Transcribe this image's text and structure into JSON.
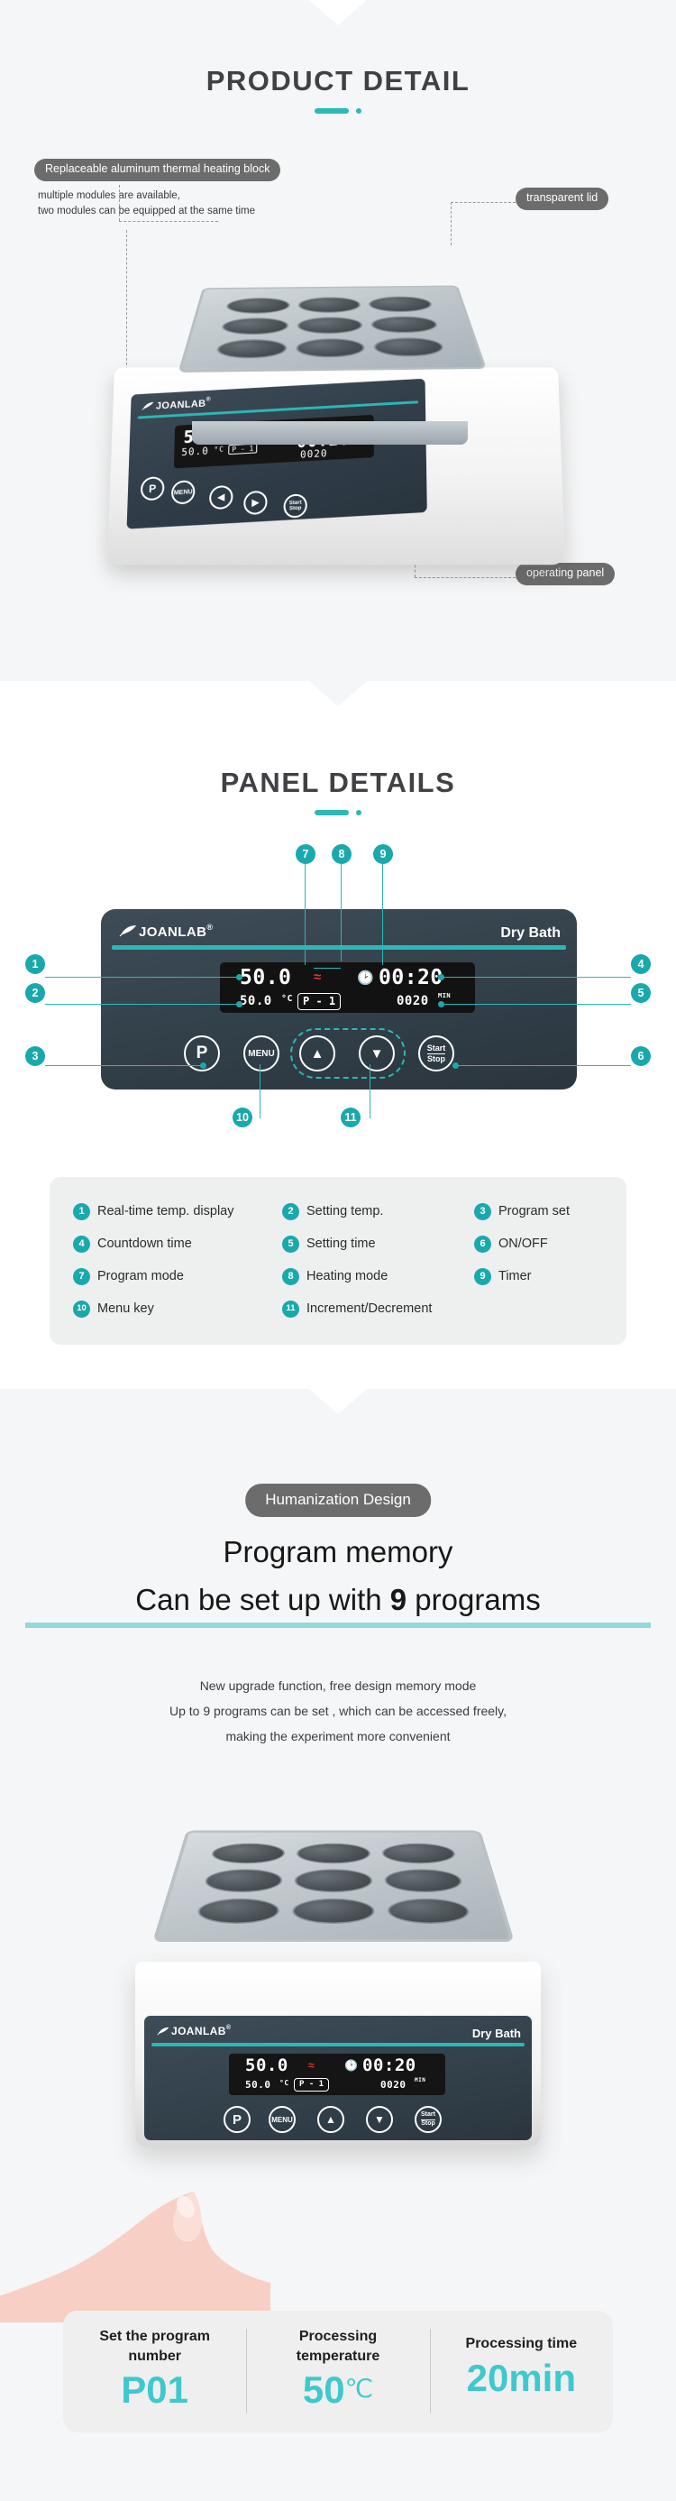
{
  "sections": {
    "product_detail": {
      "title": "PRODUCT  DETAIL",
      "labels": {
        "heating_block": "Replaceable aluminum thermal heating block",
        "heating_block_note": "multiple modules are available,\ntwo modules can be equipped at the same time",
        "transparent_lid": "transparent lid",
        "operating_panel": "operating panel"
      }
    },
    "panel_details": {
      "title": "PANEL DETAILS",
      "callouts": [
        "1",
        "2",
        "3",
        "4",
        "5",
        "6",
        "7",
        "8",
        "9",
        "10",
        "11"
      ],
      "legend": [
        {
          "num": "1",
          "label": "Real-time temp. display"
        },
        {
          "num": "2",
          "label": "Setting temp."
        },
        {
          "num": "3",
          "label": "Program set"
        },
        {
          "num": "4",
          "label": "Countdown time"
        },
        {
          "num": "5",
          "label": "Setting time"
        },
        {
          "num": "6",
          "label": "ON/OFF"
        },
        {
          "num": "7",
          "label": "Program mode"
        },
        {
          "num": "8",
          "label": "Heating mode"
        },
        {
          "num": "9",
          "label": "Timer"
        },
        {
          "num": "10",
          "label": "Menu key"
        },
        {
          "num": "11",
          "label": "Increment/Decrement"
        }
      ]
    },
    "humanization": {
      "badge": "Humanization Design",
      "headline_line1": "Program memory",
      "headline_line2_pre": "Can be set up with ",
      "headline_line2_strong": "9",
      "headline_line2_post": " programs",
      "paragraph": "New upgrade function, free design memory mode\nUp to 9 programs can be set , which can be accessed freely,\nmaking the experiment more convenient"
    }
  },
  "device": {
    "brand": "JOANLAB",
    "model": "Dry Bath",
    "display": {
      "current_temp": "50.0",
      "set_temp": "50.0",
      "temp_unit": "°C",
      "program": "P - 1",
      "countdown": "00:20",
      "set_time": "0020",
      "time_unit": "MIN"
    },
    "buttons": {
      "program": "P",
      "menu": "MENU",
      "up": "▲",
      "down": "▼",
      "start_line1": "Start",
      "start_line2": "Stop"
    },
    "icons": {
      "heat": "heat-wave-icon",
      "clock": "clock-icon"
    }
  },
  "spec_bar": [
    {
      "label": "Set the program\nnumber",
      "value": "P01",
      "unit": ""
    },
    {
      "label": "Processing\ntemperature",
      "value": "50",
      "unit": "℃"
    },
    {
      "label": "Processing time",
      "value": "20min",
      "unit": ""
    }
  ],
  "colors": {
    "accent": "#2bb8b8",
    "accent_dark": "#19a9ad",
    "spec_value": "#3fc8cd",
    "pill_bg": "#6c6c6c",
    "panel_dark": "#32404a",
    "heat_red": "#e03a2f"
  }
}
